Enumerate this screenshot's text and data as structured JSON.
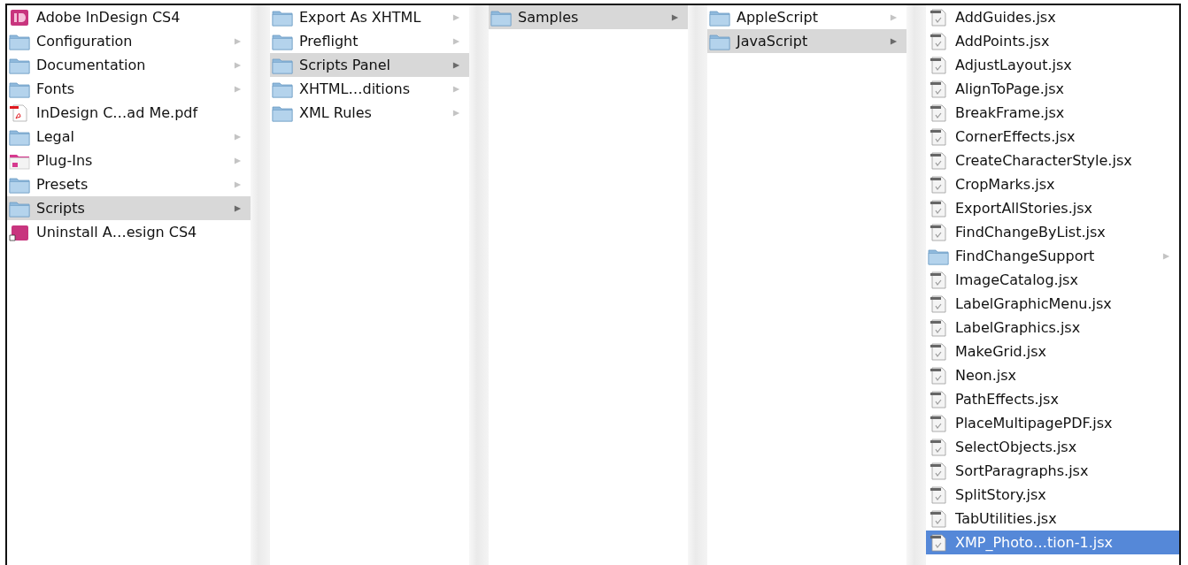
{
  "columns": [
    {
      "focused": false,
      "items": [
        {
          "name": "Adobe InDesign CS4",
          "kind": "app",
          "selected": false
        },
        {
          "name": "Configuration",
          "kind": "folder",
          "selected": false
        },
        {
          "name": "Documentation",
          "kind": "folder",
          "selected": false
        },
        {
          "name": "Fonts",
          "kind": "folder",
          "selected": false
        },
        {
          "name": "InDesign C…ad Me.pdf",
          "kind": "pdf",
          "selected": false
        },
        {
          "name": "Legal",
          "kind": "folder",
          "selected": false
        },
        {
          "name": "Plug-Ins",
          "kind": "plugins",
          "selected": false
        },
        {
          "name": "Presets",
          "kind": "folder",
          "selected": false
        },
        {
          "name": "Scripts",
          "kind": "folder",
          "selected": true
        },
        {
          "name": "Uninstall A…esign CS4",
          "kind": "installer",
          "selected": false
        }
      ]
    },
    {
      "focused": false,
      "items": [
        {
          "name": "Export As XHTML",
          "kind": "folder",
          "selected": false
        },
        {
          "name": "Preflight",
          "kind": "folder",
          "selected": false
        },
        {
          "name": "Scripts Panel",
          "kind": "folder",
          "selected": true
        },
        {
          "name": "XHTML…ditions",
          "kind": "folder",
          "selected": false
        },
        {
          "name": "XML Rules",
          "kind": "folder",
          "selected": false
        }
      ]
    },
    {
      "focused": false,
      "items": [
        {
          "name": "Samples",
          "kind": "folder",
          "selected": true
        }
      ]
    },
    {
      "focused": false,
      "items": [
        {
          "name": "AppleScript",
          "kind": "folder",
          "selected": false
        },
        {
          "name": "JavaScript",
          "kind": "folder",
          "selected": true
        }
      ]
    },
    {
      "focused": true,
      "items": [
        {
          "name": "AddGuides.jsx",
          "kind": "script",
          "selected": false
        },
        {
          "name": "AddPoints.jsx",
          "kind": "script",
          "selected": false
        },
        {
          "name": "AdjustLayout.jsx",
          "kind": "script",
          "selected": false
        },
        {
          "name": "AlignToPage.jsx",
          "kind": "script",
          "selected": false
        },
        {
          "name": "BreakFrame.jsx",
          "kind": "script",
          "selected": false
        },
        {
          "name": "CornerEffects.jsx",
          "kind": "script",
          "selected": false
        },
        {
          "name": "CreateCharacterStyle.jsx",
          "kind": "script",
          "selected": false
        },
        {
          "name": "CropMarks.jsx",
          "kind": "script",
          "selected": false
        },
        {
          "name": "ExportAllStories.jsx",
          "kind": "script",
          "selected": false
        },
        {
          "name": "FindChangeByList.jsx",
          "kind": "script",
          "selected": false
        },
        {
          "name": "FindChangeSupport",
          "kind": "folder",
          "selected": false
        },
        {
          "name": "ImageCatalog.jsx",
          "kind": "script",
          "selected": false
        },
        {
          "name": "LabelGraphicMenu.jsx",
          "kind": "script",
          "selected": false
        },
        {
          "name": "LabelGraphics.jsx",
          "kind": "script",
          "selected": false
        },
        {
          "name": "MakeGrid.jsx",
          "kind": "script",
          "selected": false
        },
        {
          "name": "Neon.jsx",
          "kind": "script",
          "selected": false
        },
        {
          "name": "PathEffects.jsx",
          "kind": "script",
          "selected": false
        },
        {
          "name": "PlaceMultipagePDF.jsx",
          "kind": "script",
          "selected": false
        },
        {
          "name": "SelectObjects.jsx",
          "kind": "script",
          "selected": false
        },
        {
          "name": "SortParagraphs.jsx",
          "kind": "script",
          "selected": false
        },
        {
          "name": "SplitStory.jsx",
          "kind": "script",
          "selected": false
        },
        {
          "name": "TabUtilities.jsx",
          "kind": "script",
          "selected": false
        },
        {
          "name": "XMP_Photo…tion-1.jsx",
          "kind": "script",
          "selected": true
        }
      ]
    }
  ]
}
